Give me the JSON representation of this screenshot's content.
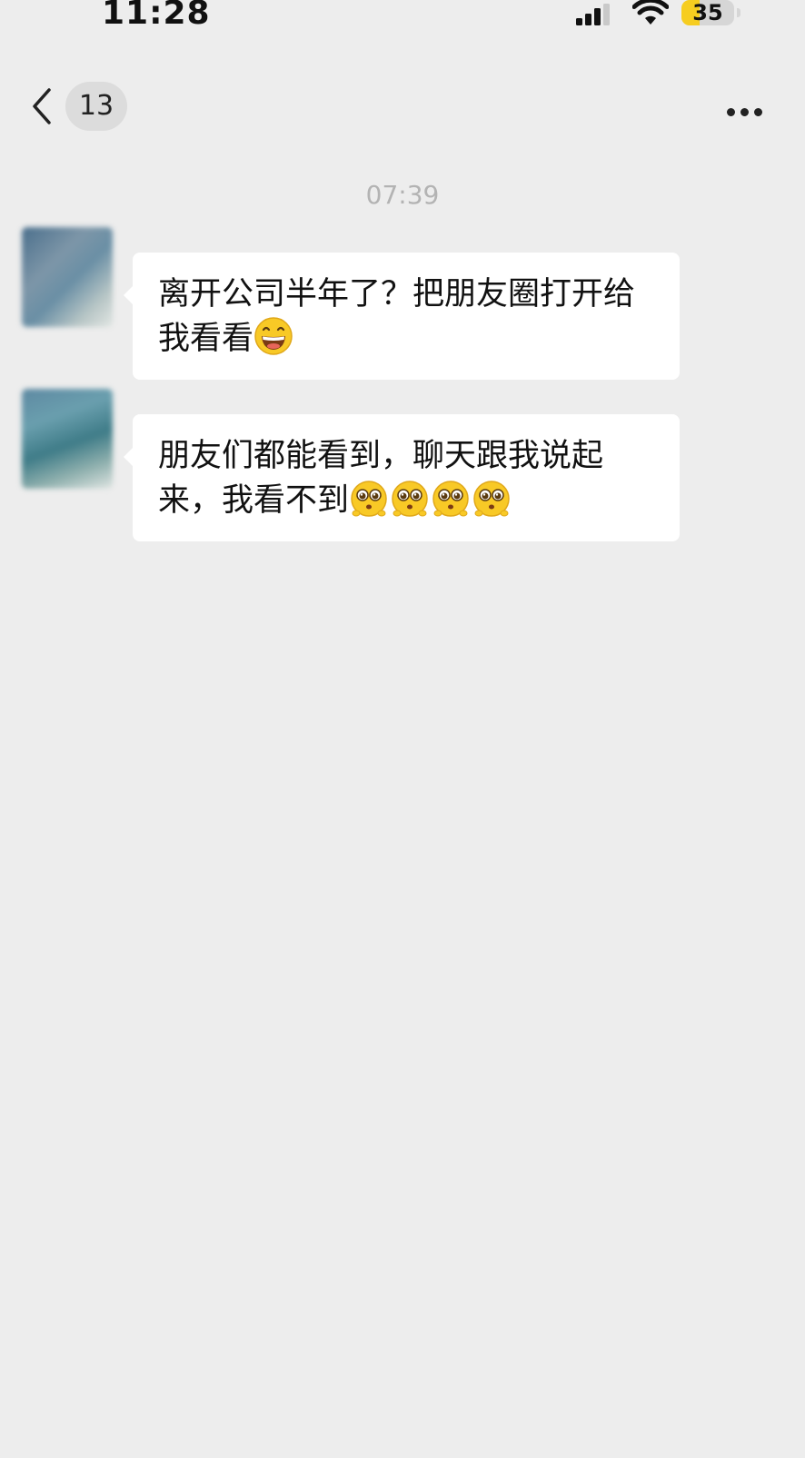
{
  "status_bar": {
    "time": "11:28",
    "battery_level": "35",
    "battery_fraction": 0.35,
    "signal_icon": "cellular-signal-icon",
    "wifi_icon": "wifi-icon",
    "accent_battery": "#f6cd20"
  },
  "nav": {
    "back_icon": "chevron-left-icon",
    "unread_count": "13",
    "more_icon": "more-dots-icon"
  },
  "chat": {
    "timestamp": "07:39",
    "messages": [
      {
        "text": "离开公司半年了？把朋友圈打开给我看看",
        "emojis": [
          "grinning-face-emoji"
        ]
      },
      {
        "text": "朋友们都能看到，聊天跟我说起来，我看不到",
        "emojis": [
          "pleading-face-emoji",
          "pleading-face-emoji",
          "pleading-face-emoji",
          "pleading-face-emoji"
        ]
      }
    ]
  },
  "colors": {
    "background": "#ededed",
    "bubble": "#ffffff",
    "timestamp_text": "#b3b3b3"
  }
}
